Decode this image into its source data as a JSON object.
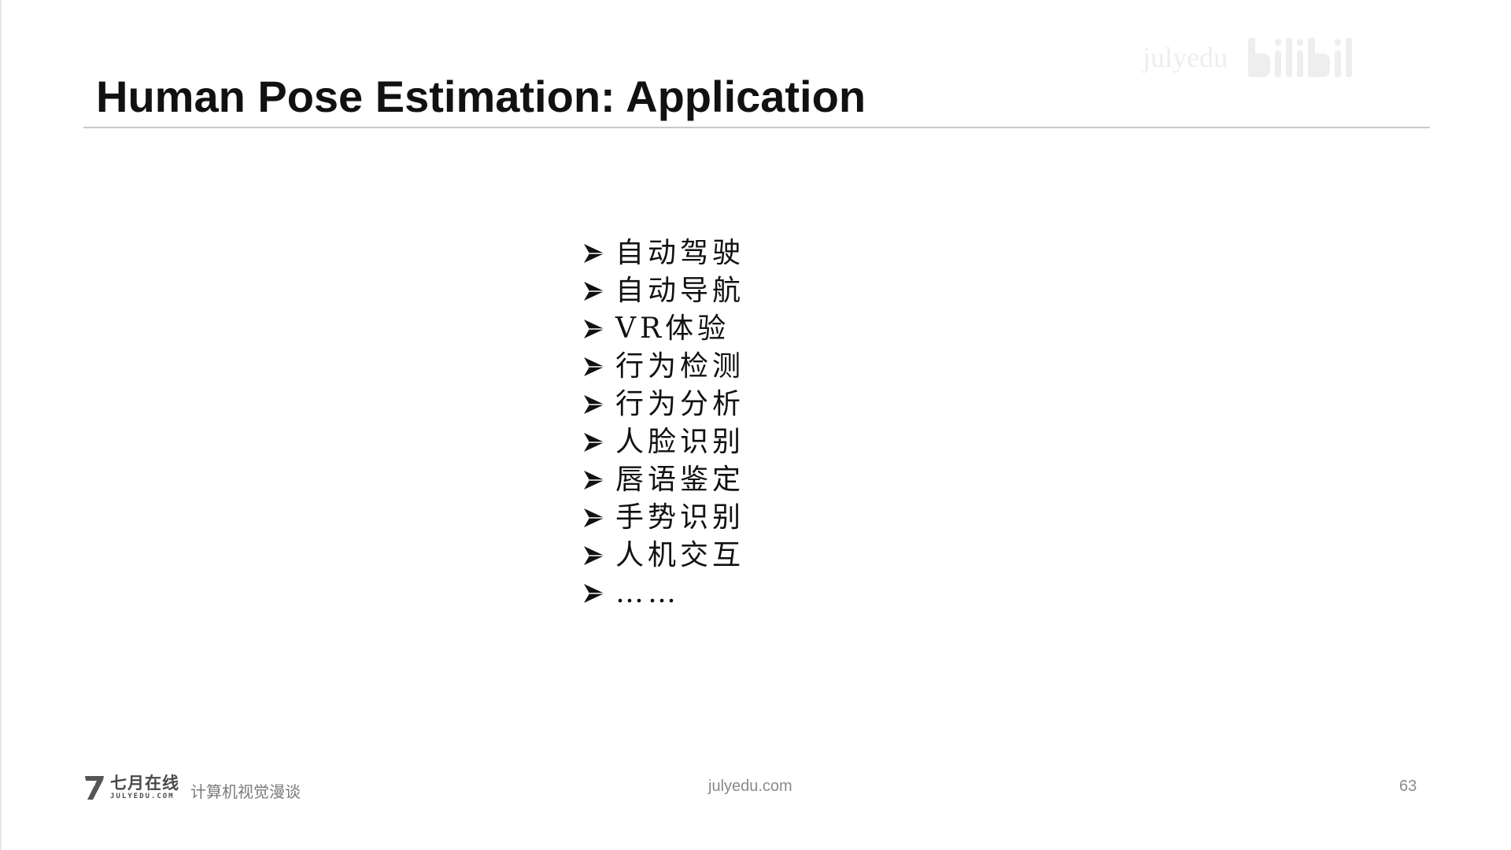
{
  "slide": {
    "title": "Human Pose Estimation: Application",
    "bullets": [
      "自动驾驶",
      "自动导航",
      "VR体验",
      "行为检测",
      "行为分析",
      "人脸识别",
      "唇语鉴定",
      "手势识别",
      "人机交互",
      "……"
    ],
    "bullet_icon": "arrow-bullet-icon"
  },
  "watermark": {
    "text": "julyedu",
    "logo_icon": "bilibili-logo-icon"
  },
  "footer": {
    "brand_name": "七月在线",
    "brand_domain": "JULYEDU.COM",
    "course_name": "计算机视觉漫谈",
    "url": "julyedu.com",
    "page_number": "63"
  },
  "colors": {
    "title": "#111111",
    "rule": "#c9c9c9",
    "footer_text": "#8a8a8a"
  }
}
